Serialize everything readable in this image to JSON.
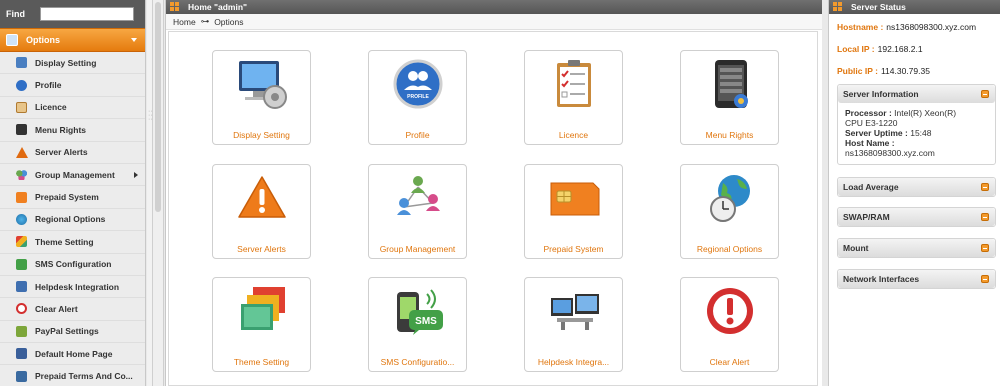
{
  "sidebar": {
    "find_label": "Find",
    "find_value": "",
    "section_title": "Options",
    "items": [
      {
        "label": "Display Setting",
        "icon": "monitor-icon",
        "color": "#4a7fc1"
      },
      {
        "label": "Profile",
        "icon": "profile-icon",
        "color": "#2f6fc6"
      },
      {
        "label": "Licence",
        "icon": "clipboard-icon",
        "color": "#e0a050"
      },
      {
        "label": "Menu Rights",
        "icon": "phone-menu-icon",
        "color": "#333333"
      },
      {
        "label": "Server Alerts",
        "icon": "warning-icon",
        "color": "#e06a10"
      },
      {
        "label": "Group Management",
        "icon": "group-icon",
        "color": "#6aa84f"
      },
      {
        "label": "Prepaid System",
        "icon": "sim-card-icon",
        "color": "#f08020"
      },
      {
        "label": "Regional Options",
        "icon": "globe-icon",
        "color": "#2d8ac9"
      },
      {
        "label": "Theme Setting",
        "icon": "theme-icon",
        "color": "#3aa070"
      },
      {
        "label": "SMS Configuration",
        "icon": "sms-icon",
        "color": "#43a047"
      },
      {
        "label": "Helpdesk Integration",
        "icon": "helpdesk-icon",
        "color": "#3f6fb0"
      },
      {
        "label": "Clear Alert",
        "icon": "clear-alert-icon",
        "color": "#d32f2f"
      },
      {
        "label": "PayPal Settings",
        "icon": "paypal-icon",
        "color": "#7da63a"
      },
      {
        "label": "Default Home Page",
        "icon": "home-page-icon",
        "color": "#3a5f9a"
      },
      {
        "label": "Prepaid Terms And Co...",
        "icon": "terms-icon",
        "color": "#3a6aa0"
      }
    ]
  },
  "main": {
    "title": "Home \"admin\"",
    "breadcrumb": {
      "home": "Home",
      "separator": "⊶",
      "current": "Options"
    },
    "tiles": [
      {
        "label": "Display Setting",
        "icon": "display-setting-icon"
      },
      {
        "label": "Profile",
        "icon": "profile-icon"
      },
      {
        "label": "Licence",
        "icon": "licence-icon"
      },
      {
        "label": "Menu Rights",
        "icon": "menu-rights-icon"
      },
      {
        "label": "Server Alerts",
        "icon": "server-alerts-icon"
      },
      {
        "label": "Group Management",
        "icon": "group-management-icon"
      },
      {
        "label": "Prepaid System",
        "icon": "prepaid-system-icon"
      },
      {
        "label": "Regional Options",
        "icon": "regional-options-icon"
      },
      {
        "label": "Theme Setting",
        "icon": "theme-setting-icon"
      },
      {
        "label": "SMS Configuratio...",
        "icon": "sms-configuration-icon"
      },
      {
        "label": "Helpdesk Integra...",
        "icon": "helpdesk-integration-icon"
      },
      {
        "label": "Clear Alert",
        "icon": "clear-alert-icon"
      }
    ]
  },
  "server_status": {
    "title": "Server Status",
    "hostname_label": "Hostname :",
    "hostname": "ns1368098300.xyz.com",
    "local_ip_label": "Local IP :",
    "local_ip": "192.168.2.1",
    "public_ip_label": "Public IP :",
    "public_ip": "114.30.79.35",
    "server_information": {
      "title": "Server Information",
      "processor_label": "Processor :",
      "processor_line1": "Intel(R) Xeon(R)",
      "processor_line2": "CPU E3-1220",
      "uptime_label": "Server Uptime :",
      "uptime": "15:48",
      "host_label": "Host Name :",
      "host": "ns1368098300.xyz.com"
    },
    "sections": [
      "Load Average",
      "SWAP/RAM",
      "Mount",
      "Network Interfaces"
    ]
  },
  "colors": {
    "accent": "#e0760e",
    "header": "#5a5a5a",
    "orange": "#f39a2c"
  }
}
